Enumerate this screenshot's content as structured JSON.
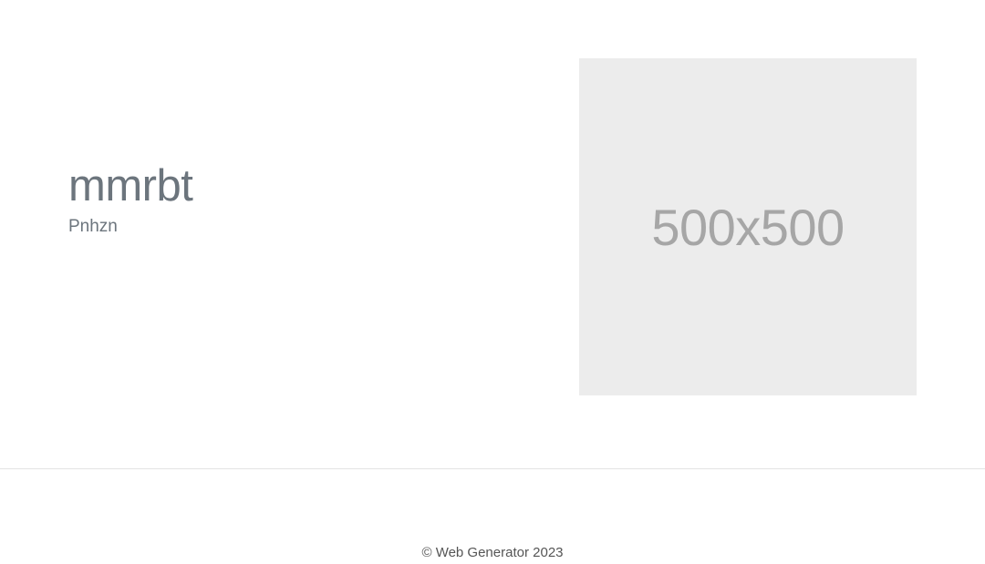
{
  "hero": {
    "title": "mmrbt",
    "subtitle": "Pnhzn",
    "image_label": "500x500"
  },
  "footer": {
    "copyright": "© Web Generator 2023"
  },
  "colors": {
    "text_muted": "#6c757d",
    "placeholder_bg": "#ececec",
    "placeholder_text": "#a6a6a6",
    "divider": "#e3e3e3"
  }
}
